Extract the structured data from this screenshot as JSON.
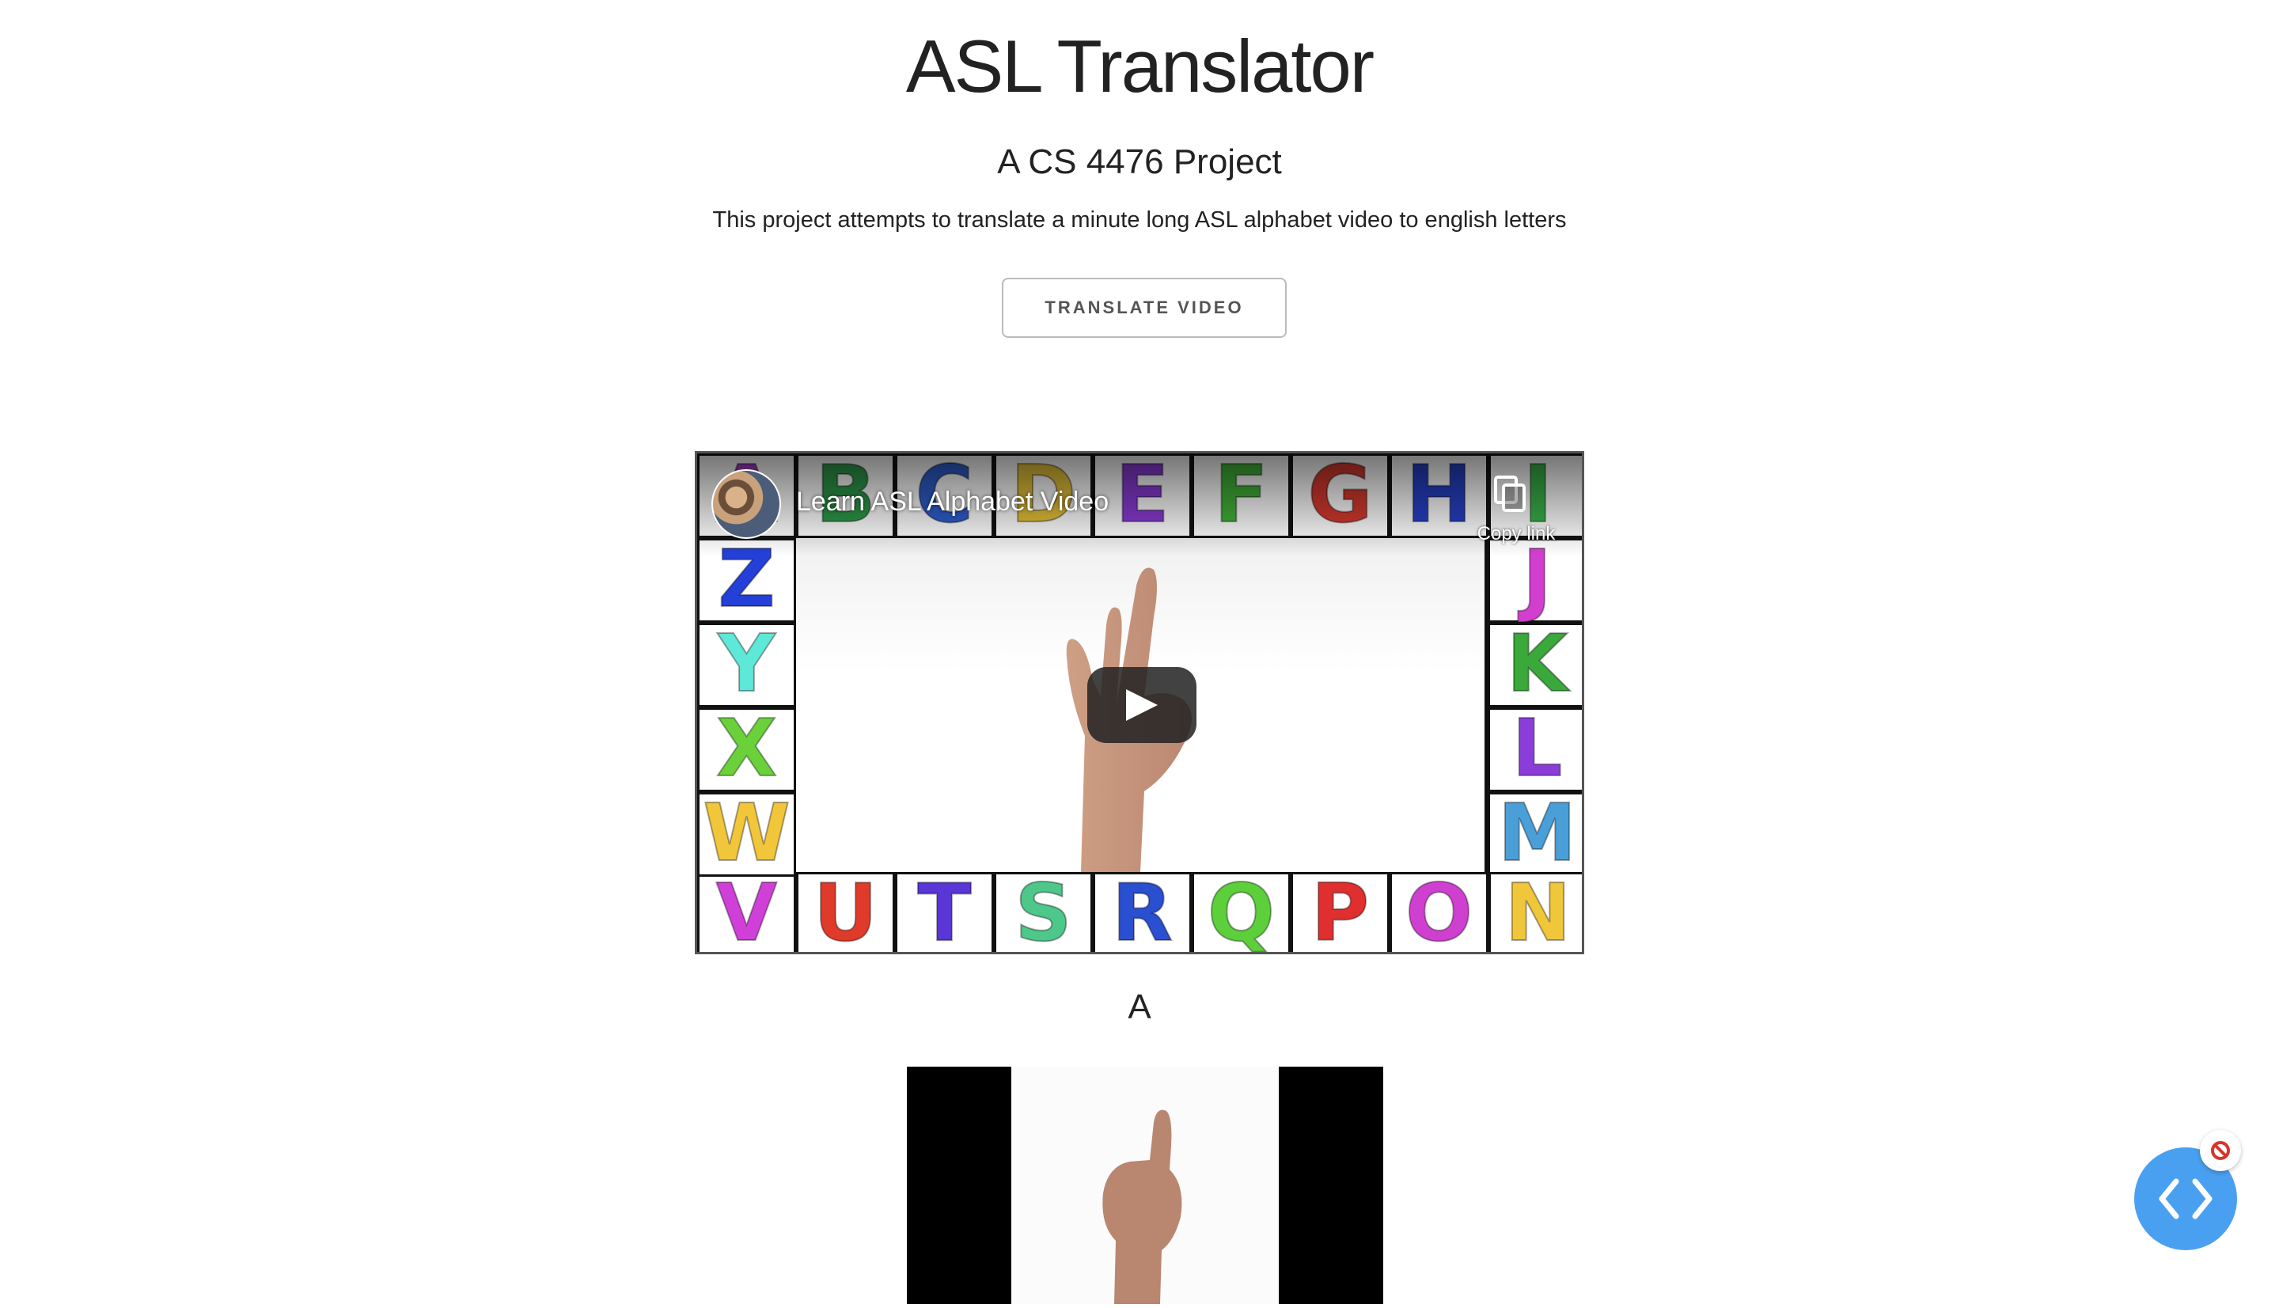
{
  "header": {
    "title": "ASL Translator",
    "subtitle": "A CS 4476 Project",
    "description": "This project attempts to translate a minute long ASL alphabet video to english letters"
  },
  "actions": {
    "translate_label": "TRANSLATE VIDEO"
  },
  "video": {
    "title": "Learn ASL Alphabet Video",
    "copy_link_label": "Copy link",
    "play_icon": "play-icon",
    "copy_icon": "copy-link-icon",
    "alphabet": {
      "top": [
        {
          "letter": "A",
          "color": "#a23fc4"
        },
        {
          "letter": "B",
          "color": "#2e9a4a"
        },
        {
          "letter": "C",
          "color": "#2f5fd0"
        },
        {
          "letter": "D",
          "color": "#e6c23a"
        },
        {
          "letter": "E",
          "color": "#8a3bd6"
        },
        {
          "letter": "F",
          "color": "#43b33a"
        },
        {
          "letter": "G",
          "color": "#d63a2f"
        },
        {
          "letter": "H",
          "color": "#2740c8"
        },
        {
          "letter": "I",
          "color": "#3ab34a"
        }
      ],
      "right": [
        {
          "letter": "J",
          "color": "#d23fcf"
        },
        {
          "letter": "K",
          "color": "#3aa83a"
        },
        {
          "letter": "L",
          "color": "#8b3dd9"
        },
        {
          "letter": "M",
          "color": "#4a9fd8"
        }
      ],
      "bottom": [
        {
          "letter": "V",
          "color": "#d040d8"
        },
        {
          "letter": "U",
          "color": "#e03a2a"
        },
        {
          "letter": "T",
          "color": "#5a36d6"
        },
        {
          "letter": "S",
          "color": "#4ec78a"
        },
        {
          "letter": "R",
          "color": "#2a4fd0"
        },
        {
          "letter": "Q",
          "color": "#5ccf3a"
        },
        {
          "letter": "P",
          "color": "#e02f2f"
        },
        {
          "letter": "O",
          "color": "#d040d0"
        },
        {
          "letter": "N",
          "color": "#f0c63a"
        }
      ],
      "left": [
        {
          "letter": "Z",
          "color": "#2440d8"
        },
        {
          "letter": "Y",
          "color": "#5de8d8"
        },
        {
          "letter": "X",
          "color": "#6ad13a"
        },
        {
          "letter": "W",
          "color": "#f2c63a"
        }
      ]
    }
  },
  "result": {
    "current_letter": "A"
  },
  "widgets": {
    "devtools_icon": "code-brackets-icon",
    "block_icon": "block-icon",
    "fab_color": "#4aa0f0"
  }
}
